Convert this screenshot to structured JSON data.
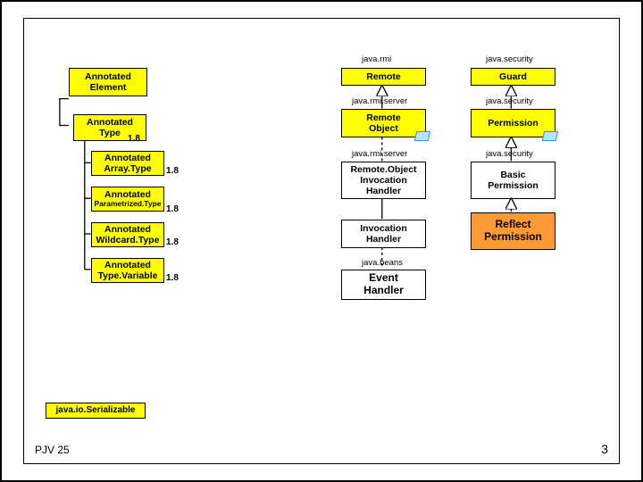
{
  "packages": {
    "java_rmi": "java.rmi",
    "java_security": "java.security",
    "java_rmi_server": "java.rmi.server",
    "java_security2": "java.security",
    "java_rmi_server2": "java.rmi.server",
    "java_security3": "java.security",
    "java_beans": "java.beans"
  },
  "left": {
    "element": "Annotated\nElement",
    "type": "Annotated\nType",
    "array": "Annotated\nArray.Type",
    "param": "Annotated",
    "param_sub": "Parametrized.Type",
    "wildcard": "Annotated\nWildcard.Type",
    "typevar": "Annotated\nType.Variable",
    "serializable": "java.io.Serializable"
  },
  "versions": {
    "type": "1.8",
    "array": "1.8",
    "param": "1.8",
    "wildcard": "1.8",
    "typevar": "1.8"
  },
  "right": {
    "remote": "Remote",
    "guard": "Guard",
    "remote_object": "Remote\nObject",
    "permission": "Permission",
    "roih": "Remote.Object\nInvocation\nHandler",
    "basic_perm": "Basic\nPermission",
    "inv_handler": "Invocation\nHandler",
    "reflect_perm": "Reflect\nPermission",
    "event_handler": "Event\nHandler"
  },
  "footer": {
    "left": "PJV 25",
    "right": "3"
  }
}
